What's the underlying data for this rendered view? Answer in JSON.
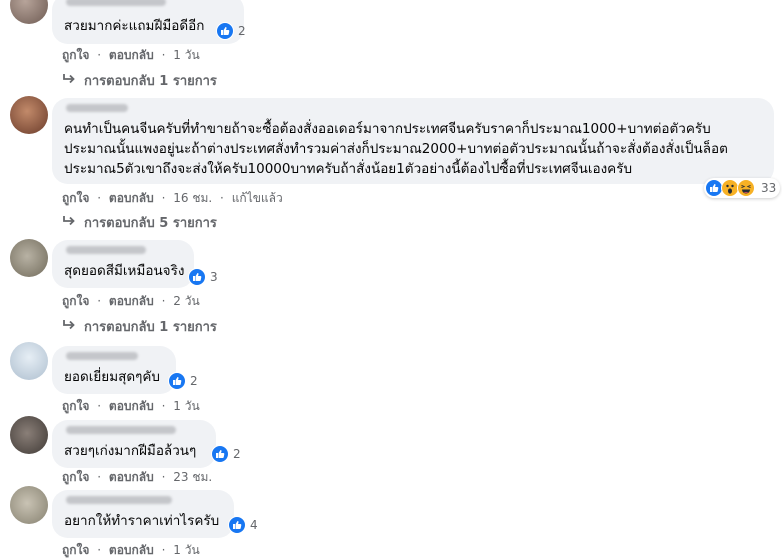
{
  "comments": [
    {
      "text_lines": [
        "สวยมากค่ะแถมฝีมือดีอีก"
      ],
      "reaction_count": "2",
      "like": "ถูกใจ",
      "reply": "ตอบกลับ",
      "time": "1 วัน",
      "replies_label": "การตอบกลับ 1 รายการ"
    },
    {
      "text_lines": [
        "คนทำเป็นคนจีนครับที่ทำขายถ้าจะซื้อต้องสั่งออเดอร์มาจากประเทศจีนครับราคาก็ประมาณ1000+บาทต่อตัวครับ",
        "ประมาณนั้นแพงอยู่นะถ้าต่างประเทศสั่งทำรวมค่าส่งก็ประมาณ2000+บาทต่อตัวประมาณนั้นถ้าจะสั่งต้องสั่งเป็นล็อต",
        "ประมาณ5ตัวเขาถึงจะส่งให้ครับ10000บาทครับถ้าสั่งน้อย1ตัวอย่างนี้ต้องไปซื้อที่ประเทศจีนเองครับ"
      ],
      "reaction_count": "33",
      "like": "ถูกใจ",
      "reply": "ตอบกลับ",
      "time": "16 ชม.",
      "edited": "แก้ไขแล้ว",
      "replies_label": "การตอบกลับ 5 รายการ"
    },
    {
      "text_lines": [
        "สุดยอดสีมีเหมือนจริง"
      ],
      "reaction_count": "3",
      "like": "ถูกใจ",
      "reply": "ตอบกลับ",
      "time": "2 วัน",
      "replies_label": "การตอบกลับ 1 รายการ"
    },
    {
      "text_lines": [
        "ยอดเยี่ยมสุดๆคับ"
      ],
      "reaction_count": "2",
      "like": "ถูกใจ",
      "reply": "ตอบกลับ",
      "time": "1 วัน"
    },
    {
      "text_lines": [
        "สวยๆเก่งมากฝีมือล้วนๆ"
      ],
      "reaction_count": "2",
      "like": "ถูกใจ",
      "reply": "ตอบกลับ",
      "time": "23 ชม."
    },
    {
      "text_lines": [
        "อยากให้ทำราคาเท่าไรครับ"
      ],
      "reaction_count": "4",
      "like": "ถูกใจ",
      "reply": "ตอบกลับ",
      "time": "1 วัน"
    }
  ],
  "separator": "·",
  "icons": {
    "like": "like-reaction-icon",
    "haha": "haha-reaction-icon",
    "wow": "wow-reaction-icon",
    "reply_arrow": "reply-arrow-icon"
  },
  "colors": {
    "like_blue": "#1877f2",
    "bubble_bg": "#f0f2f5",
    "meta_gray": "#65676b",
    "emoji_yellow": "#f7b125"
  }
}
